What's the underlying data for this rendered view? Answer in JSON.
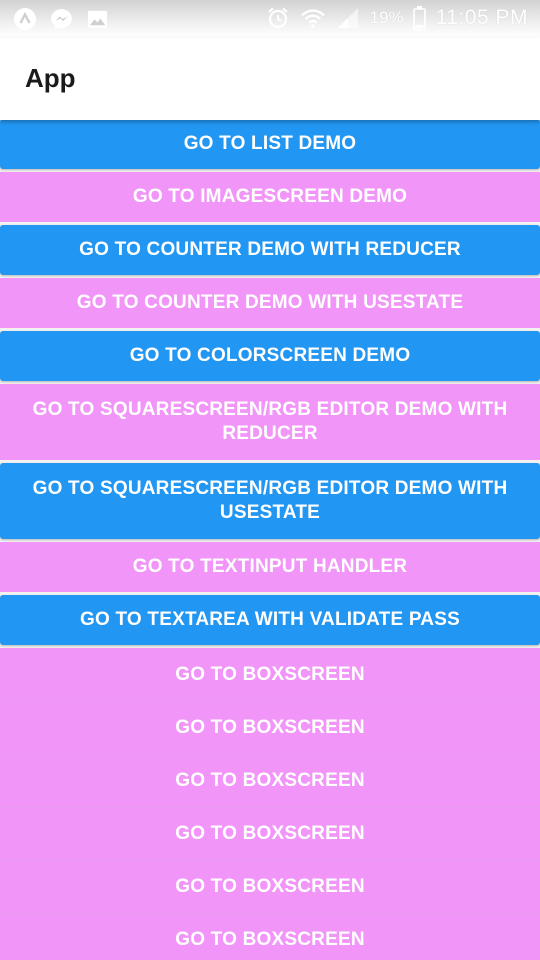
{
  "status_bar": {
    "battery": "19%",
    "time": "11:05 PM",
    "icons": [
      "app-notification-icon",
      "messenger-icon",
      "image-icon",
      "alarm-icon",
      "wifi-icon",
      "signal-icon",
      "battery-icon"
    ]
  },
  "app_bar": {
    "title": "App"
  },
  "colors": {
    "blue_button": "#2196F3",
    "pink_button": "#F196F8",
    "button_text": "#FFFFFF"
  },
  "buttons": [
    {
      "label": "GO TO LIST DEMO",
      "color": "blue"
    },
    {
      "label": "GO TO IMAGESCREEN DEMO",
      "color": "pink"
    },
    {
      "label": "GO TO COUNTER DEMO WITH REDUCER",
      "color": "blue"
    },
    {
      "label": "GO TO COUNTER DEMO WITH USESTATE",
      "color": "pink"
    },
    {
      "label": "GO TO COLORSCREEN  DEMO",
      "color": "blue"
    },
    {
      "label": "GO TO SQUARESCREEN/RGB EDITOR  DEMO WITH REDUCER",
      "color": "pink"
    },
    {
      "label": "GO TO SQUARESCREEN/RGB EDITOR  DEMO WITH USESTATE",
      "color": "blue"
    },
    {
      "label": "GO TO TEXTINPUT HANDLER",
      "color": "pink"
    },
    {
      "label": "GO TO TEXTAREA WITH VALIDATE PASS",
      "color": "blue"
    },
    {
      "label": "GO TO BOXSCREEN",
      "color": "pink"
    },
    {
      "label": "GO TO BOXSCREEN",
      "color": "pink"
    },
    {
      "label": "GO TO BOXSCREEN",
      "color": "pink"
    },
    {
      "label": "GO TO BOXSCREEN",
      "color": "pink"
    },
    {
      "label": "GO TO BOXSCREEN",
      "color": "pink"
    },
    {
      "label": "GO TO BOXSCREEN",
      "color": "pink"
    }
  ]
}
